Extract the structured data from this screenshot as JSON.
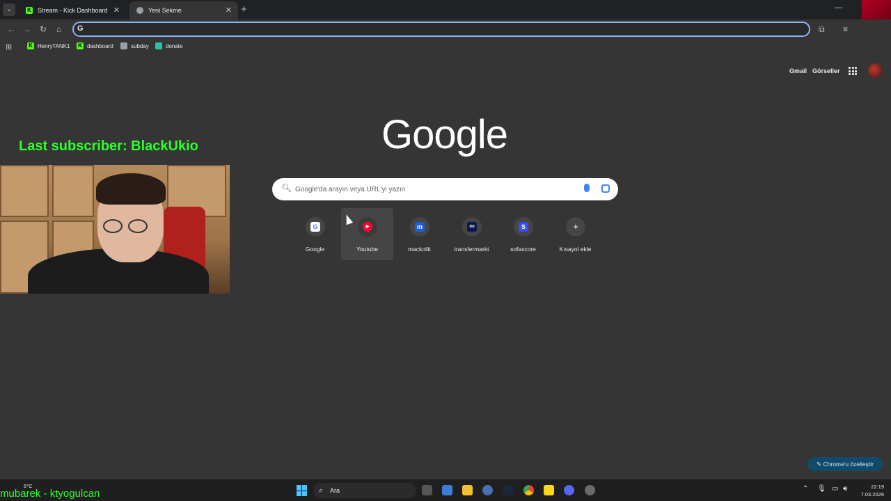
{
  "browser": {
    "tabs": [
      {
        "title": "Stream - Kick Dashboard",
        "active": false,
        "favicon": "kick-icon"
      },
      {
        "title": "Yeni Sekme",
        "active": true,
        "favicon": "chrome-icon"
      }
    ],
    "omnibox": {
      "value": "",
      "placeholder": ""
    },
    "bookmarks": [
      {
        "label": "HenryTANK1",
        "icon": "kick-icon"
      },
      {
        "label": "dashboard",
        "icon": "kick-icon"
      },
      {
        "label": "subday",
        "icon": "grid-icon"
      },
      {
        "label": "donate",
        "icon": "donate-icon"
      }
    ]
  },
  "google": {
    "header_links": {
      "gmail": "Gmail",
      "images": "Görseller"
    },
    "logo_text": "Google",
    "search_placeholder": "Google'da arayın veya URL'yi yazın",
    "shortcuts": [
      {
        "label": "Google",
        "icon": "google-icon",
        "letter": "G",
        "color": "#ffffff"
      },
      {
        "label": "Youtube",
        "icon": "youtube-icon",
        "letter": "▶",
        "color": "#ff0033"
      },
      {
        "label": "mackolik",
        "icon": "mackolik-icon",
        "letter": "m",
        "color": "#1f5fd6"
      },
      {
        "label": "transfermarkt",
        "icon": "transfermarkt-icon",
        "letter": "tm",
        "color": "#0a1a4f"
      },
      {
        "label": "sofascore",
        "icon": "sofascore-icon",
        "letter": "S",
        "color": "#374df5"
      },
      {
        "label": "Kısayol ekle",
        "icon": "plus-icon",
        "letter": "+",
        "color": "#454545"
      }
    ],
    "customize_label": "Chrome'u özelleştir"
  },
  "overlay": {
    "last_subscriber": "Last subscriber: BlackUkio",
    "bottom_ticker": "mubarek - ktyogulcan"
  },
  "taskbar": {
    "search_label": "Ara",
    "weather": "6°C",
    "time": "22:19",
    "date": "7.03.2026"
  },
  "colors": {
    "accent": "#8ab4f8",
    "overlay_green": "#2bff2b",
    "page_bg": "#353535"
  }
}
